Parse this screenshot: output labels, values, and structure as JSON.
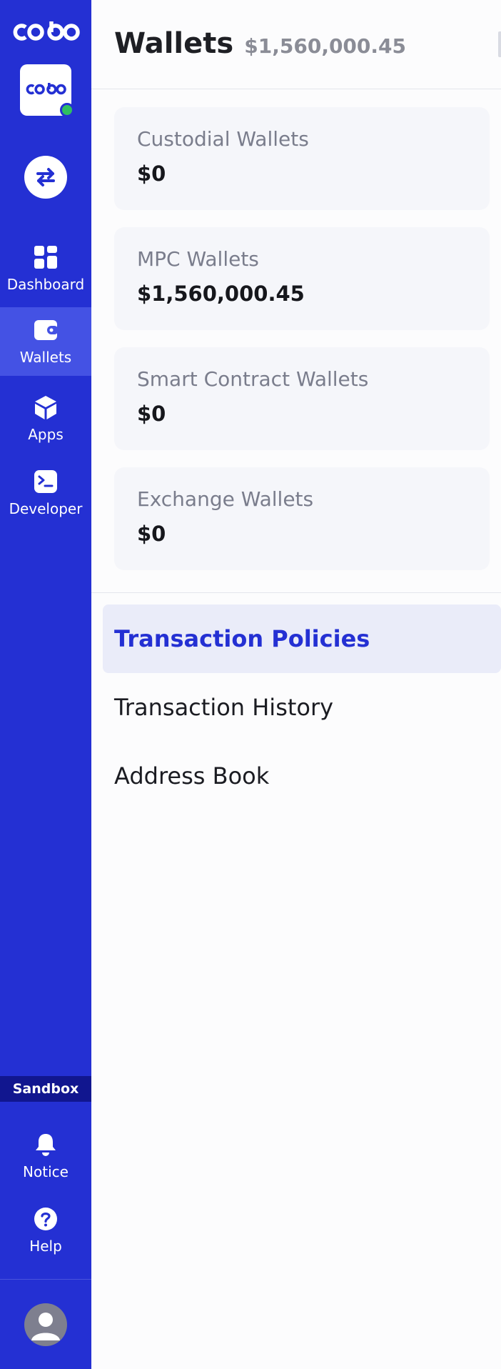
{
  "colors": {
    "sidebar": "#2430d3",
    "sidebar_active": "#4452e4",
    "env_badge": "#11168f",
    "accent": "#2430d3",
    "online": "#2fbf62",
    "card_bg": "#f5f6fa"
  },
  "sidebar": {
    "logo": "cobo-logo",
    "org_logo": "cobo-logo",
    "switch_icon": "swap-arrows-icon",
    "nav": [
      {
        "label": "Dashboard",
        "icon": "dashboard-grid-icon",
        "active": false
      },
      {
        "label": "Wallets",
        "icon": "wallet-icon",
        "active": true
      },
      {
        "label": "Apps",
        "icon": "cube-icon",
        "active": false
      },
      {
        "label": "Developer",
        "icon": "terminal-icon",
        "active": false
      }
    ],
    "environment_badge": "Sandbox",
    "bottom": [
      {
        "label": "Notice",
        "icon": "bell-icon"
      },
      {
        "label": "Help",
        "icon": "help-circle-icon"
      }
    ],
    "avatar_icon": "user-avatar-icon"
  },
  "header": {
    "title": "Wallets",
    "total": "$1,560,000.45"
  },
  "wallet_types": [
    {
      "name": "Custodial Wallets",
      "amount": "$0"
    },
    {
      "name": "MPC Wallets",
      "amount": "$1,560,000.45"
    },
    {
      "name": "Smart Contract Wallets",
      "amount": "$0"
    },
    {
      "name": "Exchange Wallets",
      "amount": "$0"
    }
  ],
  "menu": [
    {
      "label": "Transaction Policies",
      "active": true
    },
    {
      "label": "Transaction History",
      "active": false
    },
    {
      "label": "Address Book",
      "active": false
    }
  ]
}
